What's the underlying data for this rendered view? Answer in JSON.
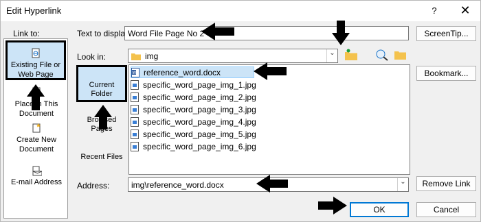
{
  "window": {
    "title": "Edit Hyperlink",
    "help": "?",
    "close": "✕"
  },
  "link_to": {
    "label": "Link to:",
    "items": [
      {
        "label_line1": "Existing File or",
        "label_line2": "Web Page",
        "icon": "globe-file-icon",
        "selected": true
      },
      {
        "label_line1": "Place in This",
        "label_line2": "Document",
        "icon": "document-place-icon",
        "selected": false
      },
      {
        "label_line1": "Create New",
        "label_line2": "Document",
        "icon": "new-document-icon",
        "selected": false
      },
      {
        "label_line1": "E-mail Address",
        "label_line2": "",
        "icon": "email-icon",
        "selected": false
      }
    ]
  },
  "text_to_display": {
    "label": "Text to display:",
    "value": "Word File Page No 2"
  },
  "screentip_button": "ScreenTip...",
  "look_in": {
    "label": "Look in:",
    "value": "img"
  },
  "browse_tabs": {
    "current_folder": "Current Folder",
    "browsed_pages": "Browsed Pages",
    "recent_files": "Recent Files"
  },
  "files": [
    "reference_word.docx",
    "specific_word_page_img_1.jpg",
    "specific_word_page_img_2.jpg",
    "specific_word_page_img_3.jpg",
    "specific_word_page_img_4.jpg",
    "specific_word_page_img_5.jpg",
    "specific_word_page_img_6.jpg"
  ],
  "selected_file_index": 0,
  "bookmark_button": "Bookmark...",
  "address": {
    "label": "Address:",
    "value": "img\\reference_word.docx"
  },
  "remove_link_button": "Remove Link",
  "ok_button": "OK",
  "cancel_button": "Cancel",
  "colors": {
    "selection": "#cce4f7",
    "accent": "#0078d4"
  }
}
